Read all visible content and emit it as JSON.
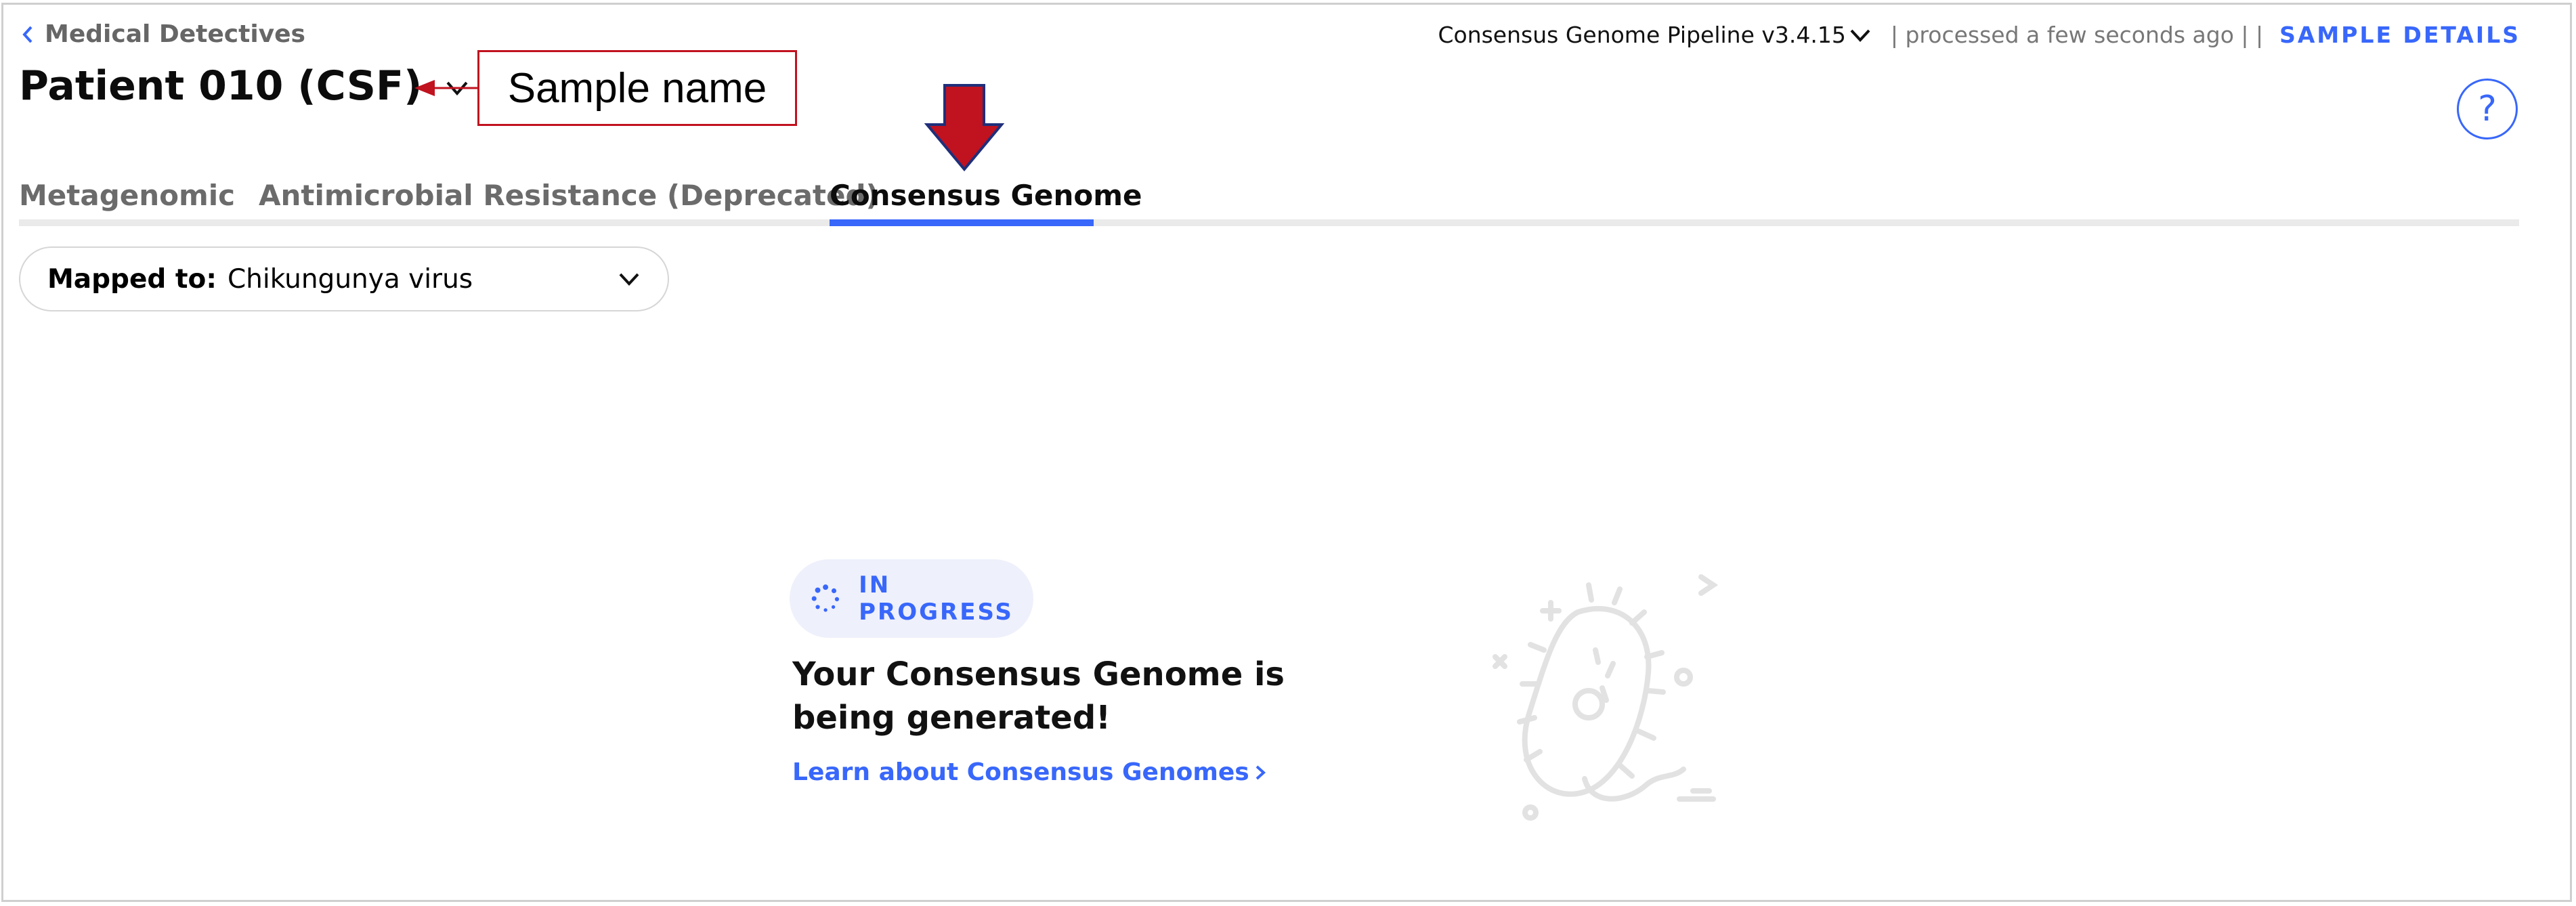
{
  "breadcrumb": {
    "label": "Medical Detectives"
  },
  "sample": {
    "title": "Patient 010 (CSF)"
  },
  "annotation": {
    "callout_text": "Sample name",
    "callout_color": "#c1121f"
  },
  "header": {
    "pipeline": "Consensus Genome Pipeline v3.4.15",
    "processed": "| processed a few seconds ago | |",
    "sample_details": "SAMPLE DETAILS",
    "help": "?"
  },
  "tabs": [
    {
      "label": "Metagenomic",
      "active": false
    },
    {
      "label": "Antimicrobial Resistance (Deprecated)",
      "active": false
    },
    {
      "label": "Consensus Genome",
      "active": true
    }
  ],
  "mapped": {
    "label": "Mapped to:",
    "value": "Chikungunya virus"
  },
  "status": {
    "badge": "IN PROGRESS",
    "headline": "Your Consensus Genome is being generated!",
    "link": "Learn about Consensus Genomes"
  },
  "colors": {
    "accent": "#3867fa",
    "badge_bg": "#eef0fb",
    "tab_line": "#eaeaea",
    "annotation_arrow": "#c1121f"
  },
  "icons": [
    "chevron-left-icon",
    "chevron-down-icon",
    "help-icon",
    "spinner-icon",
    "chevron-right-icon",
    "bacteria-illustration"
  ]
}
